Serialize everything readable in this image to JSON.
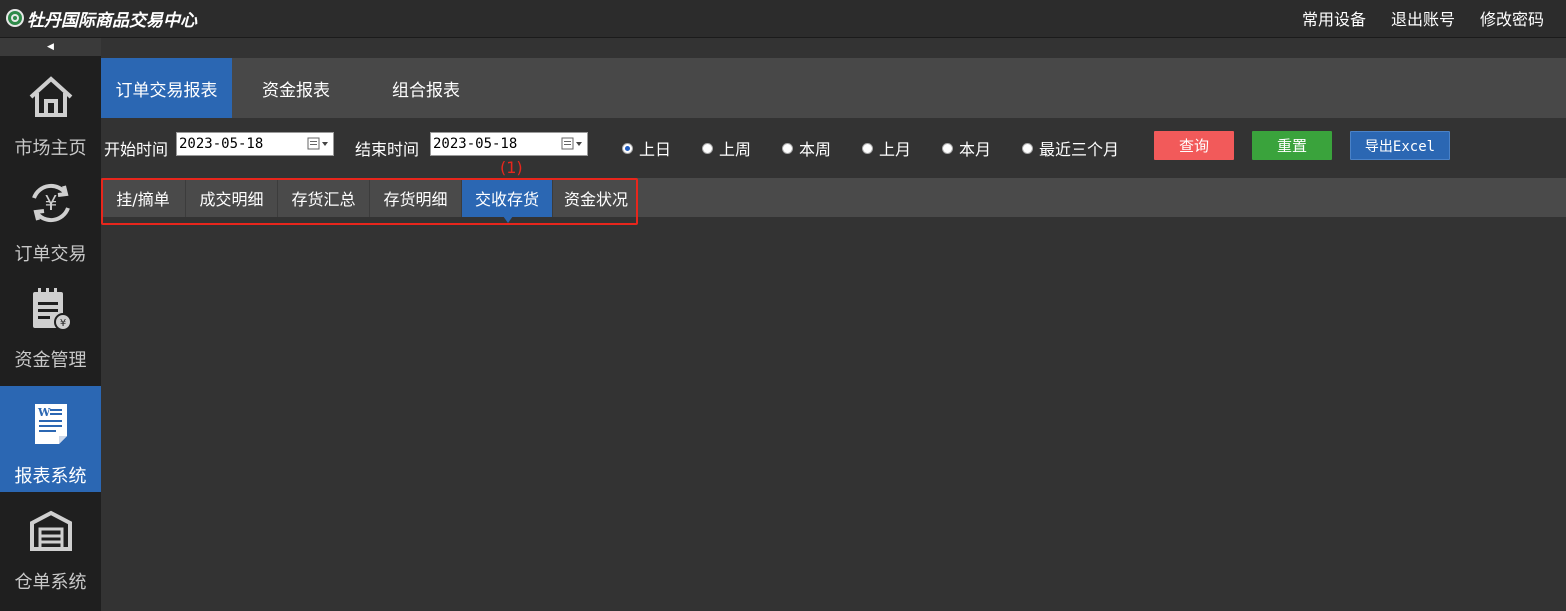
{
  "header": {
    "logo_text": "牡丹国际商品交易中心",
    "links": [
      "常用设备",
      "退出账号",
      "修改密码"
    ]
  },
  "sidebar": {
    "collapse_glyph": "◀",
    "items": [
      {
        "label": "市场主页",
        "icon": "home-icon"
      },
      {
        "label": "订单交易",
        "icon": "yen-exchange-icon"
      },
      {
        "label": "资金管理",
        "icon": "fund-notebook-icon"
      },
      {
        "label": "报表系统",
        "icon": "report-document-icon",
        "active": true
      },
      {
        "label": "仓单系统",
        "icon": "warehouse-icon"
      }
    ]
  },
  "main_tabs": [
    {
      "label": "订单交易报表",
      "active": true
    },
    {
      "label": "资金报表"
    },
    {
      "label": "组合报表"
    }
  ],
  "filters": {
    "start_label": "开始时间",
    "start_value": "2023-05-18",
    "end_label": "结束时间",
    "end_value": "2023-05-18",
    "periods": [
      {
        "label": "上日",
        "selected": true
      },
      {
        "label": "上周"
      },
      {
        "label": "本周"
      },
      {
        "label": "上月"
      },
      {
        "label": "本月"
      },
      {
        "label": "最近三个月"
      }
    ],
    "query_label": "查询",
    "reset_label": "重置",
    "export_label": "导出Excel"
  },
  "sub_tabs": [
    {
      "label": "挂/摘单"
    },
    {
      "label": "成交明细"
    },
    {
      "label": "存货汇总"
    },
    {
      "label": "存货明细"
    },
    {
      "label": "交收存货",
      "active": true
    },
    {
      "label": "资金状况"
    }
  ],
  "annotation": {
    "label": "(1)"
  },
  "colors": {
    "accent": "#2b67b3",
    "query": "#f25a5a",
    "reset": "#3aa33c",
    "annotation": "#e8261c"
  }
}
